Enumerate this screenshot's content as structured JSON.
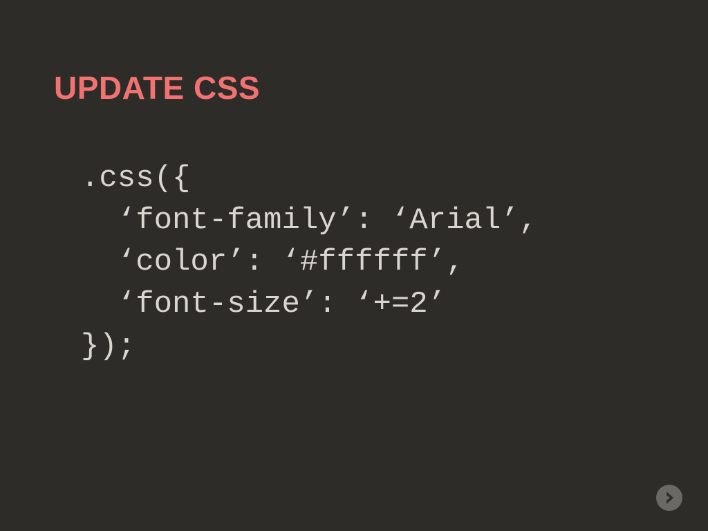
{
  "title": "UPDATE CSS",
  "code": ".css({\n  ‘font-family’: ‘Arial’,\n  ‘color’: ‘#ffffff’,\n  ‘font-size’: ‘+=2’\n});"
}
